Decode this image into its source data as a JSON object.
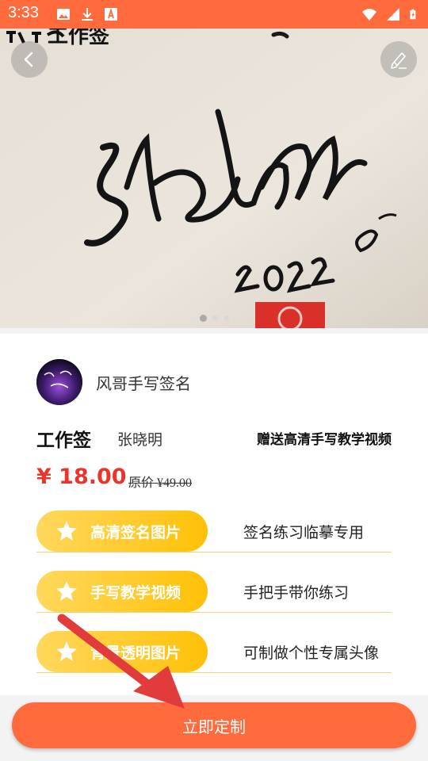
{
  "status_bar": {
    "time": "3:33",
    "icons": [
      "image-icon",
      "download-icon",
      "a-box-icon"
    ],
    "right_icons": [
      "wifi-icon",
      "signal-icon",
      "battery-charging-icon"
    ]
  },
  "hero": {
    "watermark": "工作签",
    "signature_text": "张晓明",
    "year": "2022",
    "carousel_count": 3,
    "carousel_active": 1
  },
  "shop": {
    "name": "风哥手写签名"
  },
  "product": {
    "name": "工作签",
    "signer": "张晓明",
    "gift": "赠送高清手写教学视频",
    "price": "¥ 18.00",
    "original_price": "原价 ¥49.00"
  },
  "features": [
    {
      "label": "高清签名图片",
      "desc": "签名练习临摹专用"
    },
    {
      "label": "手写教学视频",
      "desc": "手把手带你练习"
    },
    {
      "label": "背景透明图片",
      "desc": "可制做个性专属头像"
    }
  ],
  "cta": {
    "label": "立即定制"
  },
  "colors": {
    "accent": "#ff6b3d",
    "price": "#e8372a",
    "pill": "#ffc107"
  }
}
